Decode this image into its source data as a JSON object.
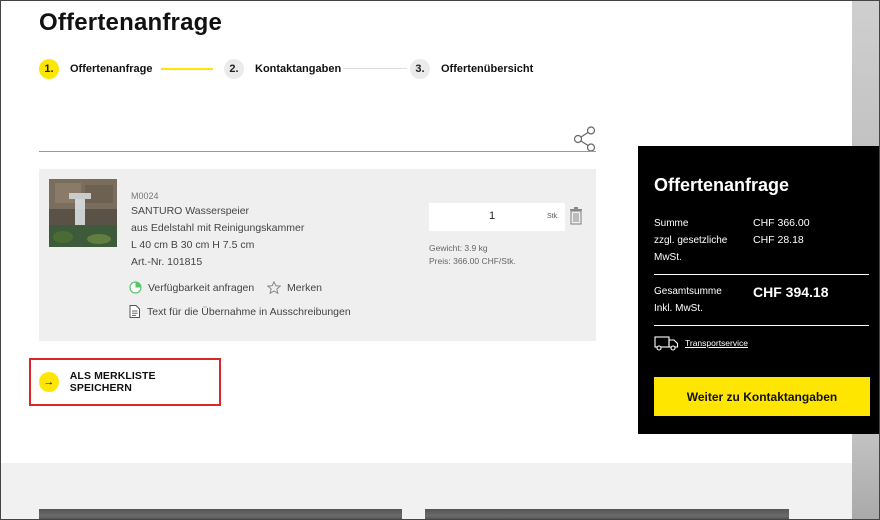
{
  "page": {
    "title": "Offertenanfrage"
  },
  "steps": [
    {
      "num": "1.",
      "label": "Offertenanfrage",
      "active": true
    },
    {
      "num": "2.",
      "label": "Kontaktangaben",
      "active": false
    },
    {
      "num": "3.",
      "label": "Offertenübersicht",
      "active": false
    }
  ],
  "product": {
    "code": "M0024",
    "name": "SANTURO Wasserspeier",
    "description": "aus Edelstahl mit Reinigungskammer",
    "dimensions": "L 40 cm B 30 cm H 7.5 cm",
    "article": "Art.-Nr. 101815",
    "quantity": "1",
    "unit": "Stk.",
    "weight": "Gewicht: 3.9 kg",
    "price": "Preis: 366.00 CHF/Stk.",
    "availability_label": "Verfügbarkeit anfragen",
    "remember_label": "Merken",
    "tender_text_label": "Text für die Übernahme in Ausschreibungen"
  },
  "save_wishlist_label": "ALS MERKLISTE SPEICHERN",
  "summary": {
    "title": "Offertenanfrage",
    "sum_label": "Summe",
    "sum_value": "CHF 366.00",
    "vat_label_1": "zzgl. gesetzliche",
    "vat_label_2": "MwSt.",
    "vat_value": "CHF 28.18",
    "total_label_1": "Gesamtsumme",
    "total_label_2": "Inkl. MwSt.",
    "total_value": "CHF 394.18",
    "transport_label": "Transportservice",
    "cta_label": "Weiter zu Kontaktangaben"
  },
  "colors": {
    "accent": "#ffe600",
    "highlight_border": "#d9262a",
    "summary_bg": "#000000"
  }
}
